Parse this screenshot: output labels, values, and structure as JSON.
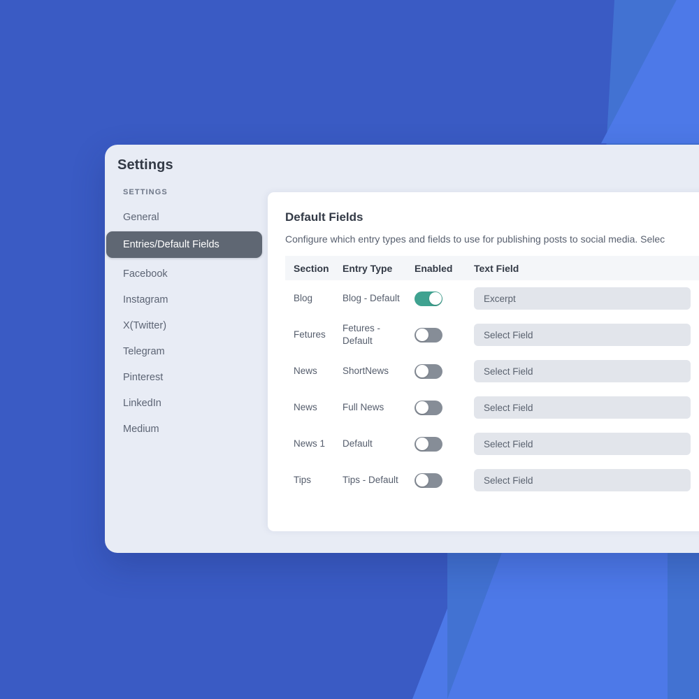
{
  "background": {
    "base_color": "#3a5bc4",
    "accent_mid": "#4272d2",
    "accent_bright": "#4d79e8"
  },
  "card": {
    "title": "Settings",
    "surface_color": "#e8ecf5"
  },
  "sidebar": {
    "group_label": "SETTINGS",
    "active_index": 1,
    "active_color": "#5f6773",
    "items": [
      {
        "label": "General"
      },
      {
        "label": "Entries/Default Fields"
      },
      {
        "label": "Facebook"
      },
      {
        "label": "Instagram"
      },
      {
        "label": "X(Twitter)"
      },
      {
        "label": "Telegram"
      },
      {
        "label": "Pinterest"
      },
      {
        "label": "LinkedIn"
      },
      {
        "label": "Medium"
      }
    ]
  },
  "panel": {
    "title": "Default Fields",
    "description": "Configure which entry types and fields to use for publishing posts to social media. Selec",
    "table": {
      "headers": {
        "section": "Section",
        "entry_type": "Entry Type",
        "enabled": "Enabled",
        "text_field": "Text Field"
      },
      "toggle_on_color": "#3fa290",
      "toggle_off_color": "#868d97",
      "rows": [
        {
          "section": "Blog",
          "entry_type": "Blog - Default",
          "enabled": true,
          "text_field": "Excerpt"
        },
        {
          "section": "Fetures",
          "entry_type": "Fetures - Default",
          "enabled": false,
          "text_field": "Select Field"
        },
        {
          "section": "News",
          "entry_type": "ShortNews",
          "enabled": false,
          "text_field": "Select Field"
        },
        {
          "section": "News",
          "entry_type": "Full News",
          "enabled": false,
          "text_field": "Select Field"
        },
        {
          "section": "News 1",
          "entry_type": "Default",
          "enabled": false,
          "text_field": "Select Field"
        },
        {
          "section": "Tips",
          "entry_type": "Tips - Default",
          "enabled": false,
          "text_field": "Select Field"
        }
      ]
    }
  }
}
